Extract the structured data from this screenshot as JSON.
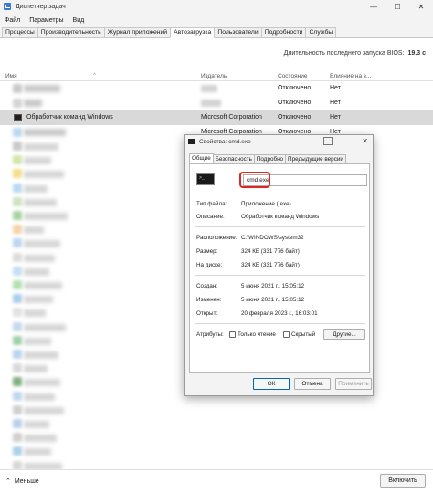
{
  "window": {
    "title": "Диспетчер задач",
    "min": "—",
    "max": "☐",
    "close": "✕"
  },
  "menu": [
    "Файл",
    "Параметры",
    "Вид"
  ],
  "tabs": [
    "Процессы",
    "Производительность",
    "Журнал приложений",
    "Автозагрузка",
    "Пользователи",
    "Подробности",
    "Службы"
  ],
  "active_tab": "Автозагрузка",
  "bios": {
    "label": "Длительность последнего запуска BIOS:",
    "value": "19.3 с"
  },
  "columns": {
    "name": "Имя",
    "publisher": "Издатель",
    "status": "Состояние",
    "impact": "Влияние на з..."
  },
  "rows": [
    {
      "name": "",
      "publisher": "",
      "status": "Отключено",
      "impact": "Нет"
    },
    {
      "name": "",
      "publisher": "",
      "status": "Отключено",
      "impact": "Нет"
    },
    {
      "name": "",
      "publisher": "",
      "status": "Отключено",
      "impact": "Нет"
    },
    {
      "name": "Обработчик команд Windows",
      "publisher": "Microsoft Corporation",
      "status": "Отключено",
      "impact": "Нет"
    },
    {
      "name": "",
      "publisher": "Microsoft Corporation",
      "status": "Отключено",
      "impact": "Нет"
    }
  ],
  "blurred_row_colors": [
    "#c9c9c9",
    "#cfe7a8",
    "#f3df8a",
    "#b9d9f2",
    "#cfe3c0",
    "#a7d3a0",
    "#f5d3a6",
    "#bcd6f0",
    "#dcdcdc",
    "#c5dff3",
    "#b5e0b0",
    "#a9cdec",
    "#e2e2e2",
    "#c6d9ee",
    "#9fd1a8",
    "#b7d4ee",
    "#d9d9d9",
    "#7fb07d",
    "#c0d8ef",
    "#d0d0d0",
    "#b8d0eb",
    "#cfcfcf",
    "#acd1ea",
    "#d7d7d7"
  ],
  "dialog": {
    "title": "Свойства: cmd.exe",
    "close": "✕",
    "tabs": [
      "Общие",
      "Безопасность",
      "Подробно",
      "Предыдущие версии"
    ],
    "active_tab": "Общие",
    "filename": "cmd.exe",
    "props_a": [
      {
        "label": "Тип файла:",
        "value": "Приложение (.exe)"
      },
      {
        "label": "Описание:",
        "value": "Обработчик команд Windows"
      }
    ],
    "props_b": [
      {
        "label": "Расположение:",
        "value": "C:\\WINDOWS\\system32"
      },
      {
        "label": "Размер:",
        "value": "324 КБ (331 776 байт)"
      },
      {
        "label": "На диске:",
        "value": "324 КБ (331 776 байт)"
      }
    ],
    "props_c": [
      {
        "label": "Создан:",
        "value": "5 июня 2021 г., 15:05:12"
      },
      {
        "label": "Изменен:",
        "value": "5 июня 2021 г., 15:05:12"
      },
      {
        "label": "Открыт:",
        "value": "20 февраля 2023 г., 16:03:01"
      }
    ],
    "attributes_label": "Атрибуты:",
    "readonly_label": "Только чтение",
    "hidden_label": "Скрытый",
    "other_button": "Другие...",
    "ok": "ОК",
    "cancel": "Отмена",
    "apply": "Применить",
    "highlight_color": "#e0281e"
  },
  "bottom": {
    "less": "Меньше",
    "enable": "Включить"
  }
}
